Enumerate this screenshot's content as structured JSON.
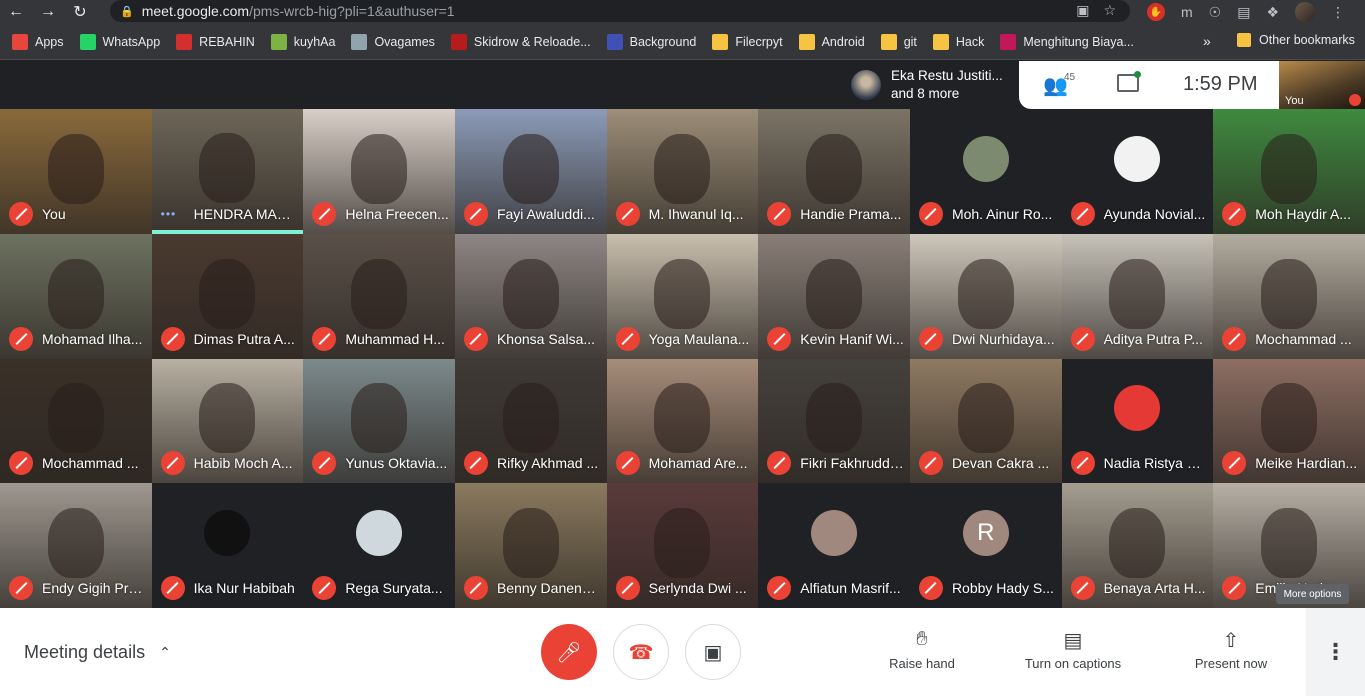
{
  "browser": {
    "url_host": "meet.google.com",
    "url_path": "/pms-wrcb-hig?pli=1&authuser=1"
  },
  "bookmarks": [
    {
      "label": "Apps",
      "color": "#e8453c"
    },
    {
      "label": "WhatsApp",
      "color": "#25d366"
    },
    {
      "label": "REBAHIN",
      "color": "#d32f2f"
    },
    {
      "label": "kuyhAa",
      "color": "#7cb342"
    },
    {
      "label": "Ovagames",
      "color": "#90a4ae"
    },
    {
      "label": "Skidrow & Reloade...",
      "color": "#b71c1c"
    },
    {
      "label": "Background",
      "color": "#3f51b5"
    },
    {
      "label": "Filecrpyt",
      "color": "#f6c342"
    },
    {
      "label": "Android",
      "color": "#f6c342"
    },
    {
      "label": "git",
      "color": "#f6c342"
    },
    {
      "label": "Hack",
      "color": "#f6c342"
    },
    {
      "label": "Menghitung Biaya...",
      "color": "#c2185b"
    }
  ],
  "bookmarks_more": "»",
  "other_bookmarks": "Other bookmarks",
  "presenter": {
    "line1": "Eka Restu Justiti...",
    "line2": "and 8 more"
  },
  "people_count": "45",
  "clock": "1:59  PM",
  "self_view_label": "You",
  "participants": [
    {
      "name": "You",
      "muted": true,
      "bg": "#8a6a3c"
    },
    {
      "name": "HENDRA MAU...",
      "muted": false,
      "speaking": true,
      "bg": "#6d6658"
    },
    {
      "name": "Helna Freecen...",
      "muted": true,
      "bg": "#d9cfc8"
    },
    {
      "name": "Fayi Awaluddi...",
      "muted": true,
      "bg": "#8c9bb8"
    },
    {
      "name": "M. Ihwanul Iq...",
      "muted": true,
      "bg": "#9c8e78"
    },
    {
      "name": "Handie Prama...",
      "muted": true,
      "bg": "#7b7466"
    },
    {
      "name": "Moh. Ainur Ro...",
      "muted": true,
      "avatar": true,
      "avatar_bg": "#7c8a6f",
      "dark": true
    },
    {
      "name": "Ayunda Novial...",
      "muted": true,
      "avatar": true,
      "avatar_bg": "#f2f2f2",
      "dark": true
    },
    {
      "name": "Moh Haydir A...",
      "muted": true,
      "bg": "#3f8a3f"
    },
    {
      "name": "Mohamad Ilha...",
      "muted": true,
      "bg": "#6d7260"
    },
    {
      "name": "Dimas Putra A...",
      "muted": true,
      "bg": "#4a3a30"
    },
    {
      "name": "Muhammad H...",
      "muted": true,
      "bg": "#5a5048"
    },
    {
      "name": "Khonsa Salsa...",
      "muted": true,
      "bg": "#8d8684"
    },
    {
      "name": "Yoga Maulana...",
      "muted": true,
      "bg": "#c9bfae"
    },
    {
      "name": "Kevin Hanif Wi...",
      "muted": true,
      "bg": "#8a7f78"
    },
    {
      "name": "Dwi Nurhidaya...",
      "muted": true,
      "bg": "#cfc8bc"
    },
    {
      "name": "Aditya Putra P...",
      "muted": true,
      "bg": "#c7c2b8"
    },
    {
      "name": "Mochammad ...",
      "muted": true,
      "bg": "#b3aca0"
    },
    {
      "name": "Mochammad ...",
      "muted": true,
      "bg": "#3a3128"
    },
    {
      "name": "Habib Moch A...",
      "muted": true,
      "bg": "#b8b0a2"
    },
    {
      "name": "Yunus Oktavia...",
      "muted": true,
      "bg": "#7c8a8c"
    },
    {
      "name": "Rifky Akhmad ...",
      "muted": true,
      "bg": "#3f3a36"
    },
    {
      "name": "Mohamad Are...",
      "muted": true,
      "bg": "#a78d7a"
    },
    {
      "name": "Fikri Fakhruddi...",
      "muted": true,
      "bg": "#45413c"
    },
    {
      "name": "Devan Cakra ...",
      "muted": true,
      "bg": "#8f7a62"
    },
    {
      "name": "Nadia Ristya D...",
      "muted": true,
      "avatar": true,
      "avatar_bg": "#e53935",
      "dark": true
    },
    {
      "name": "Meike Hardian...",
      "muted": true,
      "bg": "#8d6e63"
    },
    {
      "name": "Endy Gigih Pra...",
      "muted": true,
      "bg": "#9e9890"
    },
    {
      "name": "Ika Nur Habibah",
      "muted": true,
      "avatar": true,
      "avatar_bg": "#111111",
      "dark": true
    },
    {
      "name": "Rega Suryata...",
      "muted": true,
      "avatar": true,
      "avatar_bg": "#cfd8dc",
      "dark": true
    },
    {
      "name": "Benny Danend...",
      "muted": true,
      "bg": "#8a7a5e"
    },
    {
      "name": "Serlynda Dwi ...",
      "muted": true,
      "bg": "#5a3a3a"
    },
    {
      "name": "Alfiatun Masrif...",
      "muted": true,
      "avatar": true,
      "avatar_bg": "#a1887f",
      "dark": true
    },
    {
      "name": "Robby Hady S...",
      "muted": true,
      "avatar": true,
      "avatar_letter": "R",
      "avatar_bg": "#a1887f",
      "dark": true
    },
    {
      "name": "Benaya Arta H...",
      "muted": true,
      "bg": "#a59d90"
    },
    {
      "name": "Emilia Nurla...",
      "muted": true,
      "bg": "#b7b0a6"
    }
  ],
  "more_options_tip": "More options",
  "bottom": {
    "meeting_details": "Meeting details",
    "raise_hand": "Raise hand",
    "captions": "Turn on captions",
    "present": "Present now"
  }
}
